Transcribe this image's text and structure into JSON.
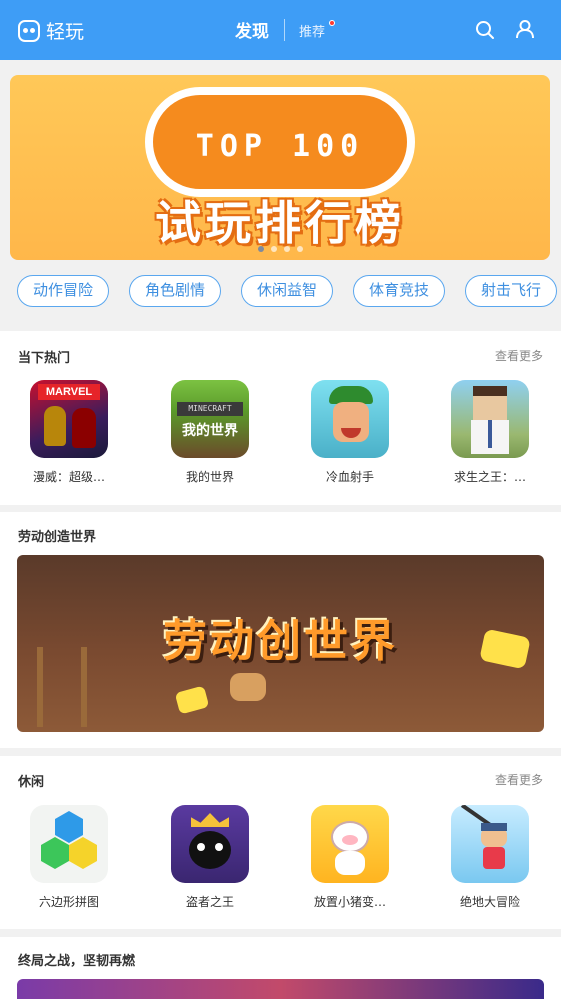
{
  "header": {
    "logo_text": "轻玩",
    "nav_discover": "发现",
    "nav_recommend": "推荐"
  },
  "banner": {
    "top_text": "TOP 100",
    "title": "试玩排行榜",
    "page_count": 4,
    "active_page": 1
  },
  "categories": [
    "动作冒险",
    "角色剧情",
    "休闲益智",
    "体育竞技",
    "射击飞行"
  ],
  "hot": {
    "title": "当下热门",
    "more": "查看更多",
    "games": [
      {
        "name": "漫威：超级…",
        "icon": "marvel-game-icon"
      },
      {
        "name": "我的世界",
        "icon": "minecraft-game-icon"
      },
      {
        "name": "冷血射手",
        "icon": "archer-game-icon"
      },
      {
        "name": "求生之王：…",
        "icon": "survival-game-icon"
      }
    ]
  },
  "labor": {
    "title": "劳动创造世界",
    "banner_text": "劳动创世界"
  },
  "casual": {
    "title": "休闲",
    "more": "查看更多",
    "games": [
      {
        "name": "六边形拼图",
        "icon": "hexagon-puzzle-icon"
      },
      {
        "name": "盗者之王",
        "icon": "thief-king-icon"
      },
      {
        "name": "放置小猪变…",
        "icon": "pig-game-icon"
      },
      {
        "name": "绝地大冒险",
        "icon": "adventure-game-icon"
      }
    ]
  },
  "endgame": {
    "title": "终局之战，坚韧再燃"
  },
  "colors": {
    "header": "#3e9df6",
    "accent": "#5aa7ef",
    "banner": "#ffb74a"
  }
}
